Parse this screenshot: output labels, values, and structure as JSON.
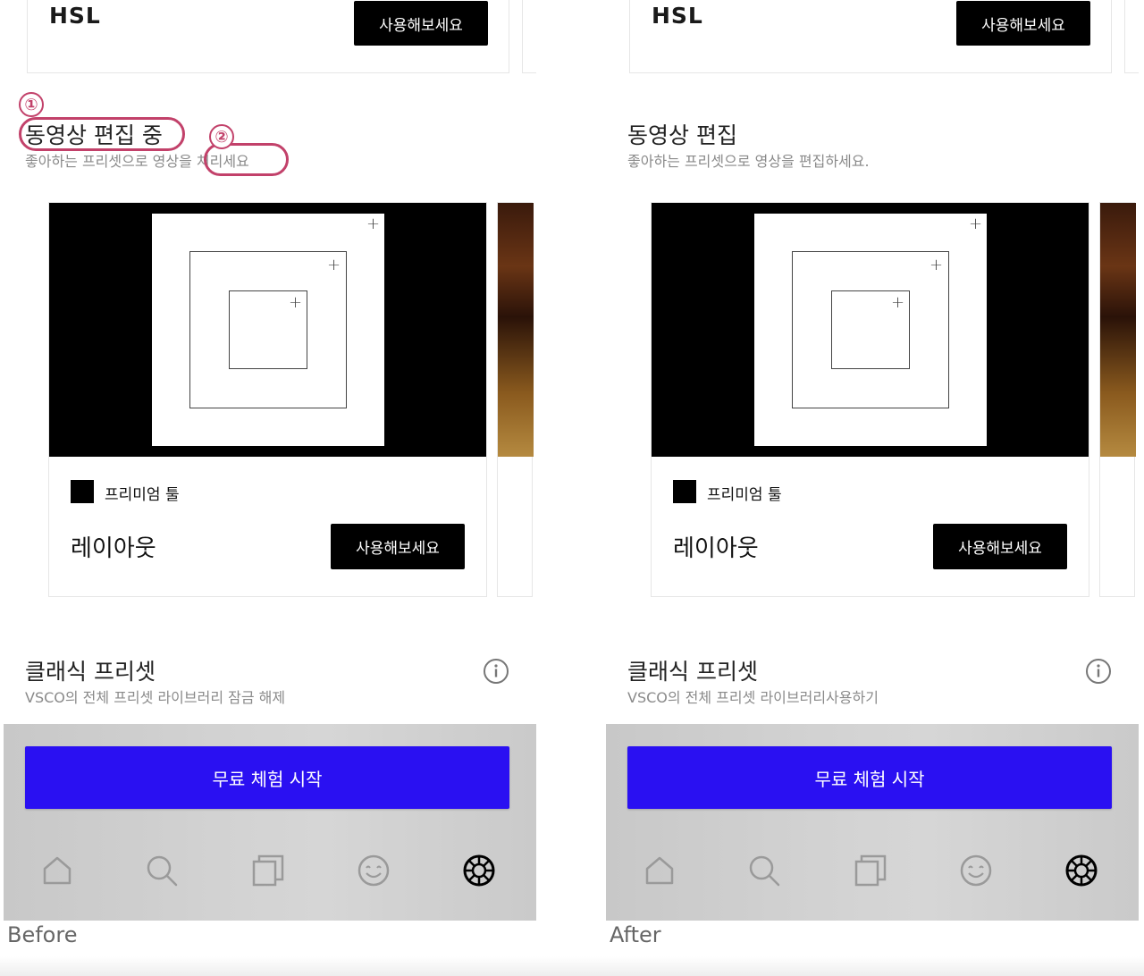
{
  "panels": [
    {
      "hsl": {
        "title": "HSL",
        "button": "사용해보세요"
      },
      "video": {
        "title": "동영상 편집 중",
        "subtitle": "좋아하는 프리셋으로 영상을 처리세요"
      },
      "tool": {
        "badge": "프리미엄 툴",
        "name": "레이아웃",
        "button": "사용해보세요"
      },
      "classic": {
        "title": "클래식 프리셋",
        "subtitle": "VSCO의 전체 프리셋 라이브러리 잠금 해제"
      },
      "trial_button": "무료 체험 시작",
      "caption": "Before"
    },
    {
      "hsl": {
        "title": "HSL",
        "button": "사용해보세요"
      },
      "video": {
        "title": "동영상 편집",
        "subtitle": "좋아하는 프리셋으로 영상을 편집하세요."
      },
      "tool": {
        "badge": "프리미엄 툴",
        "name": "레이아웃",
        "button": "사용해보세요"
      },
      "classic": {
        "title": "클래식 프리셋",
        "subtitle": "VSCO의 전체 프리셋 라이브러리사용하기"
      },
      "trial_button": "무료 체험 시작",
      "caption": "After"
    }
  ],
  "annotations": [
    {
      "number": "①",
      "target": "video-title"
    },
    {
      "number": "②",
      "target": "video-subtitle-end"
    }
  ],
  "nav_icons": [
    "home-icon",
    "search-icon",
    "library-icon",
    "smile-icon",
    "presets-wheel-icon"
  ],
  "colors": {
    "accent": "#2a10f2",
    "annotation": "#c2416a",
    "button_black": "#000000"
  }
}
